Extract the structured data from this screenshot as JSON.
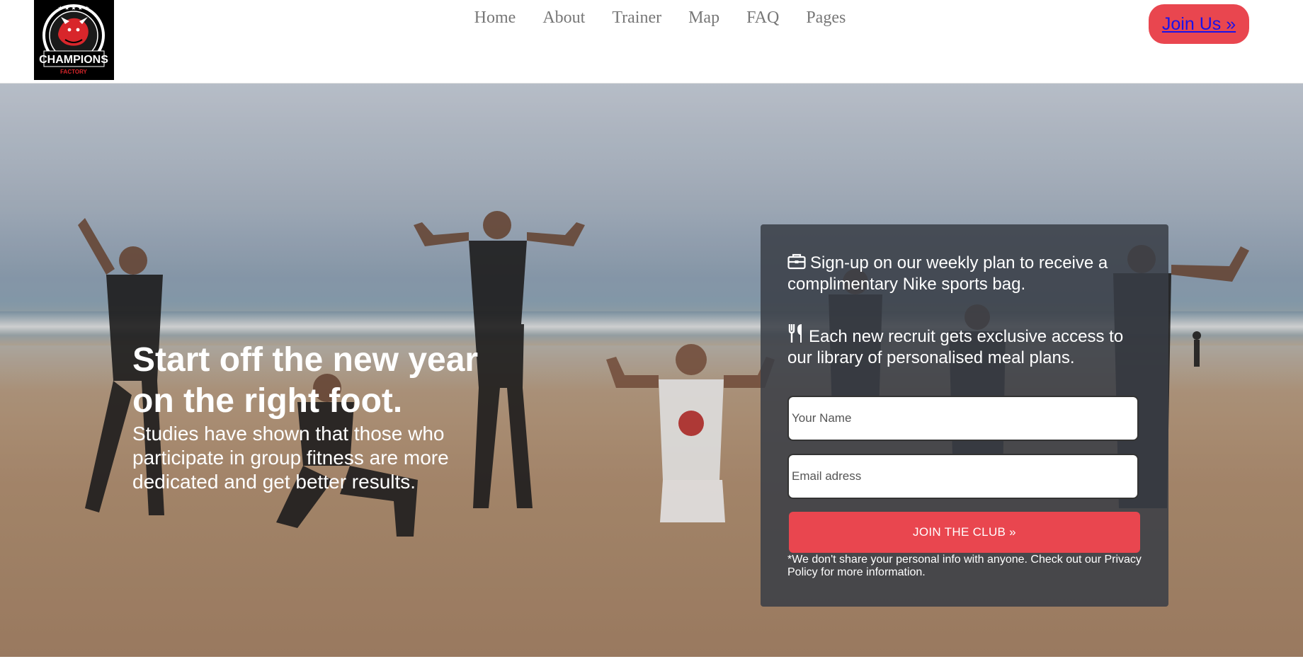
{
  "brand": {
    "logo_text": "CHAMPIONS",
    "logo_subtext": "FACTORY"
  },
  "nav": {
    "items": [
      {
        "label": "Home"
      },
      {
        "label": "About"
      },
      {
        "label": "Trainer"
      },
      {
        "label": "Map"
      },
      {
        "label": "FAQ"
      },
      {
        "label": "Pages"
      }
    ]
  },
  "header": {
    "cta_label": "Join Us »"
  },
  "hero": {
    "title": "Start off the new year on the right foot.",
    "subtitle": "Studies have shown that those who participate in group fitness are more dedicated and get better results."
  },
  "signup": {
    "perk1": {
      "icon": "briefcase-icon",
      "text": "Sign-up on our weekly plan to receive a complimentary Nike sports bag."
    },
    "perk2": {
      "icon": "utensils-icon",
      "text": "Each new recruit gets exclusive access to our library of personalised meal plans."
    },
    "name_placeholder": "Your Name",
    "email_placeholder": "Email adress",
    "button_label": "JOIN THE CLUB »",
    "disclaimer": "*We don't share your personal info with anyone. Check out our Privacy Policy for more information."
  },
  "colors": {
    "accent": "#e9464f",
    "panel": "#393e46",
    "nav_text": "#777777"
  }
}
